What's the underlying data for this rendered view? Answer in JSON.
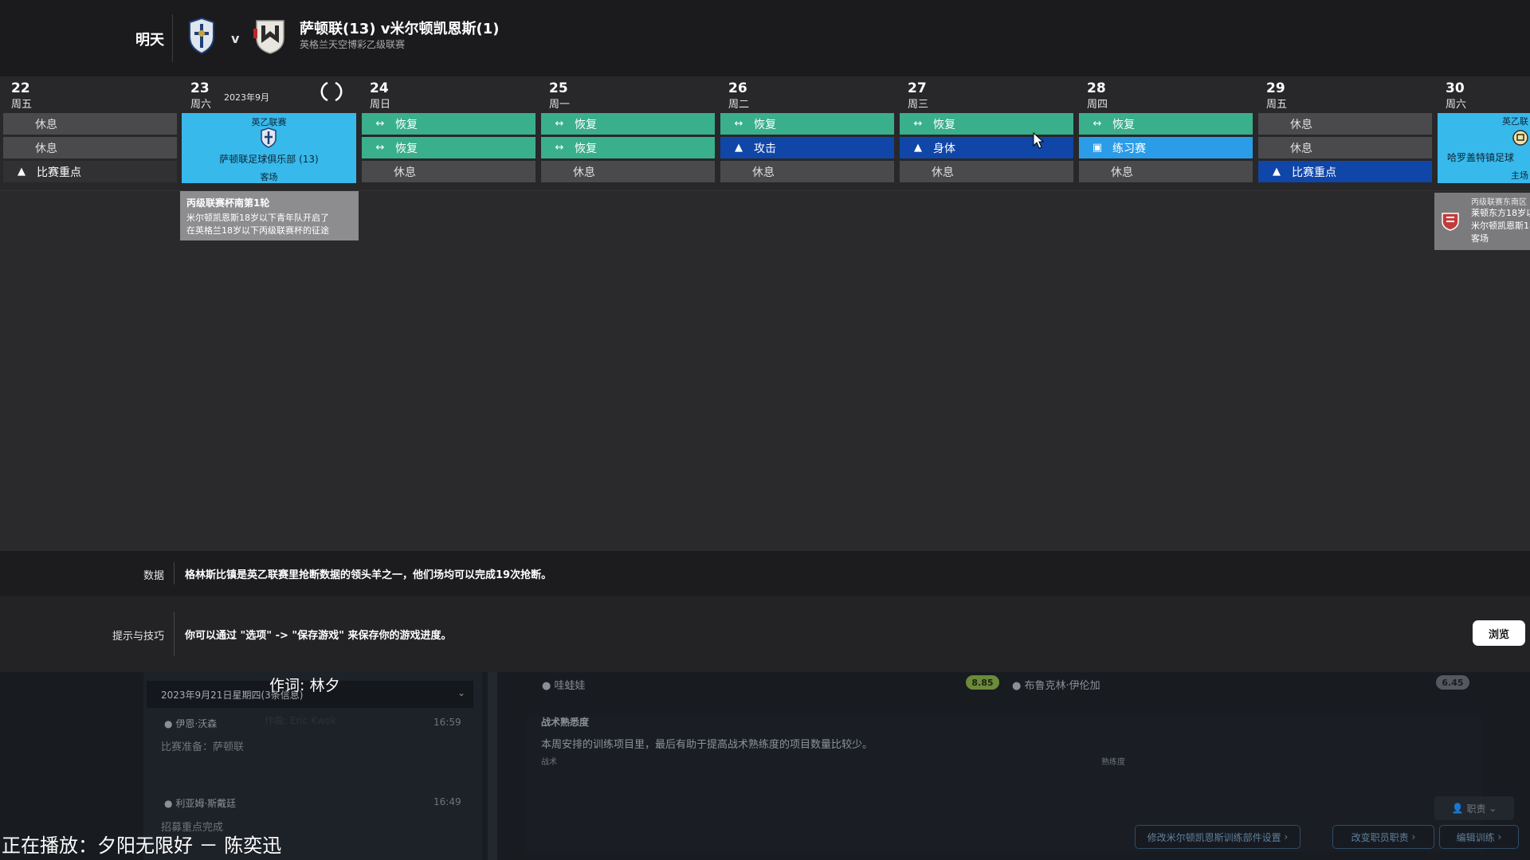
{
  "header": {
    "when": "明天",
    "vs": "v",
    "match_title": "萨顿联(13) v米尔顿凯恩斯(1)",
    "competition": "英格兰天空博彩乙级联赛"
  },
  "calendar": {
    "month_label": "2023年9月",
    "days": [
      {
        "num": "22",
        "name": "周五",
        "slots": [
          "休息",
          "休息",
          "比赛重点"
        ]
      },
      {
        "num": "23",
        "name": "周六"
      },
      {
        "num": "24",
        "name": "周日",
        "slots": [
          "恢复",
          "恢复",
          "休息"
        ]
      },
      {
        "num": "25",
        "name": "周一",
        "slots": [
          "恢复",
          "恢复",
          "休息"
        ]
      },
      {
        "num": "26",
        "name": "周二",
        "slots": [
          "恢复",
          "攻击",
          "休息"
        ]
      },
      {
        "num": "27",
        "name": "周三",
        "slots": [
          "恢复",
          "身体",
          "休息"
        ]
      },
      {
        "num": "28",
        "name": "周四",
        "slots": [
          "恢复",
          "练习赛",
          "休息"
        ]
      },
      {
        "num": "29",
        "name": "周五",
        "slots": [
          "休息",
          "休息",
          "比赛重点"
        ]
      },
      {
        "num": "30",
        "name": "周六"
      }
    ],
    "match_card": {
      "league": "英乙联赛",
      "club": "萨顿联足球俱乐部 (13)",
      "venue": "客场"
    },
    "edge_card": {
      "league": "英乙联",
      "club": "哈罗盖特镇足球",
      "venue": "主场"
    },
    "popup": {
      "title": "丙级联赛杯南第1轮",
      "line1": "米尔顿凯恩斯18岁以下青年队开启了",
      "line2": "在英格兰18岁以下丙级联赛杯的征途"
    },
    "popup2": {
      "line0": "丙级联赛东南区",
      "line1": "莱顿东方18岁以",
      "line2": "米尔顿凯恩斯18",
      "line3": "客场"
    }
  },
  "info": {
    "data_label": "数据",
    "data_text": "格林斯比镇是英乙联赛里抢断数据的领头羊之一，他们场均可以完成19次抢断。",
    "tips_label": "提示与技巧",
    "tips_text": "你可以通过 \"选项\" -> \"保存游戏\" 来保存你的游戏进度。",
    "browse": "浏览"
  },
  "lower": {
    "dropdown": "2023年9月21日星期四(3条信息)",
    "news": [
      {
        "sender": "伊恩·沃森",
        "time": "16:59",
        "subject": "比赛准备：萨顿联"
      },
      {
        "sender": "利亚姆·斯戴廷",
        "time": "16:49",
        "subject": "招募重点完成"
      }
    ],
    "players": [
      {
        "name": "哇蛙娃",
        "rating": "8.85"
      },
      {
        "name": "布鲁克林·伊伦加",
        "rating": "6.45"
      }
    ],
    "tactic_title": "战术熟悉度",
    "tactic_text": "本周安排的训练项目里，最后有助于提高战术熟练度的项目数量比较少。",
    "col_tactic": "战术",
    "col_familiarity": "熟练度",
    "role_btn": "职责",
    "actions": [
      "修改米尔顿凯恩斯训练部件设置",
      "改变职员职责",
      "编辑训练"
    ]
  },
  "overlay": {
    "lyric": "作词: 林夕",
    "lyric_faded": "作曲: Eric Kwok",
    "now_playing": "正在播放：夕阳无限好 － 陈奕迅"
  },
  "colors": {
    "recovery": "#3aaf8b",
    "attack": "#1046a8",
    "friendly": "#2b9de8",
    "rest": "#4a4a4d",
    "match": "#38b9ec"
  }
}
